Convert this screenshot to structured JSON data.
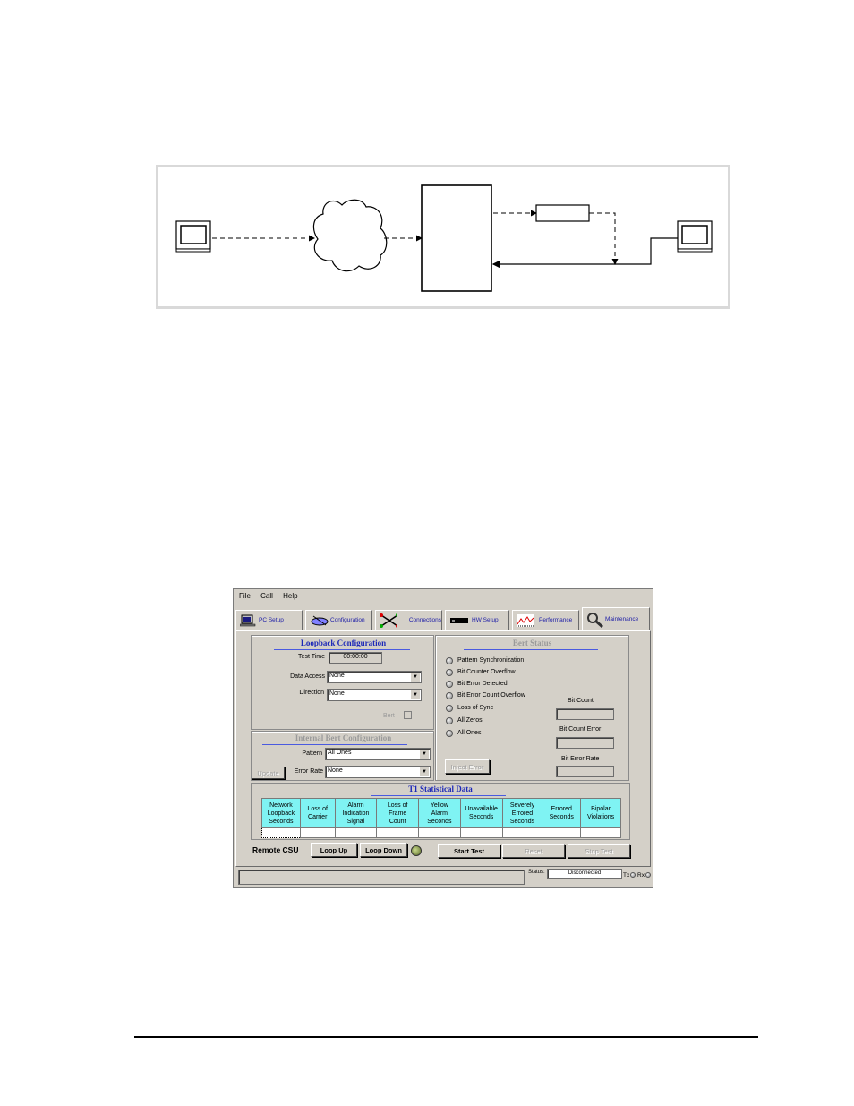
{
  "menu": [
    "File",
    "Call",
    "Help"
  ],
  "tabs": [
    {
      "label": "PC Setup",
      "icon": "computer-icon"
    },
    {
      "label": "Configuration",
      "icon": "satellite-icon"
    },
    {
      "label": "Connections",
      "icon": "cross-arrows-icon"
    },
    {
      "label": "HW Setup",
      "icon": "hardware-icon"
    },
    {
      "label": "Performance",
      "icon": "graph-icon"
    },
    {
      "label": "Maintenance",
      "icon": "wrench-icon"
    }
  ],
  "loopback": {
    "title": "Loopback Configuration",
    "test_time_label": "Test Time",
    "test_time_value": "00:00:00",
    "data_access_label": "Data Access",
    "data_access_value": "None",
    "direction_label": "Direction",
    "direction_value": "None",
    "bert_label": "Bert"
  },
  "internal_bert": {
    "title": "Internal Bert Configuration",
    "pattern_label": "Pattern",
    "pattern_value": "All Ones",
    "error_rate_label": "Error Rate",
    "error_rate_value": "None",
    "update_label": "Update"
  },
  "bert_status": {
    "title": "Bert Status",
    "items": [
      "Pattern Synchronization",
      "Bit Counter Overflow",
      "Bit Error Detected",
      "Bit Error Count Overflow",
      "Loss of Sync",
      "All Zeros",
      "All Ones"
    ],
    "bit_count_label": "Bit Count",
    "bit_count_error_label": "Bit Count Error",
    "bit_error_rate_label": "Bit Error Rate",
    "inject_error_label": "Inject Error"
  },
  "t1": {
    "title": "T1 Statistical Data",
    "columns": [
      [
        "Network",
        "Loopback",
        "Seconds"
      ],
      [
        "Loss of",
        "Carrier"
      ],
      [
        "Alarm",
        "Indication",
        "Signal"
      ],
      [
        "Loss of",
        "Frame",
        "Count"
      ],
      [
        "Yellow",
        "Alarm",
        "Seconds"
      ],
      [
        "Unavailable",
        "Seconds"
      ],
      [
        "Severely",
        "Errored",
        "Seconds"
      ],
      [
        "Errored",
        "Seconds"
      ],
      [
        "Bipolar",
        "Violations"
      ]
    ]
  },
  "remote": {
    "label": "Remote CSU",
    "loop_up": "Loop Up",
    "loop_down": "Loop Down",
    "start_test": "Start Test",
    "reset": "Reset",
    "stop_test": "Stop Test"
  },
  "status": {
    "label": "Status:",
    "value": "Disconnected",
    "tx": "Tx",
    "rx": "Rx"
  }
}
